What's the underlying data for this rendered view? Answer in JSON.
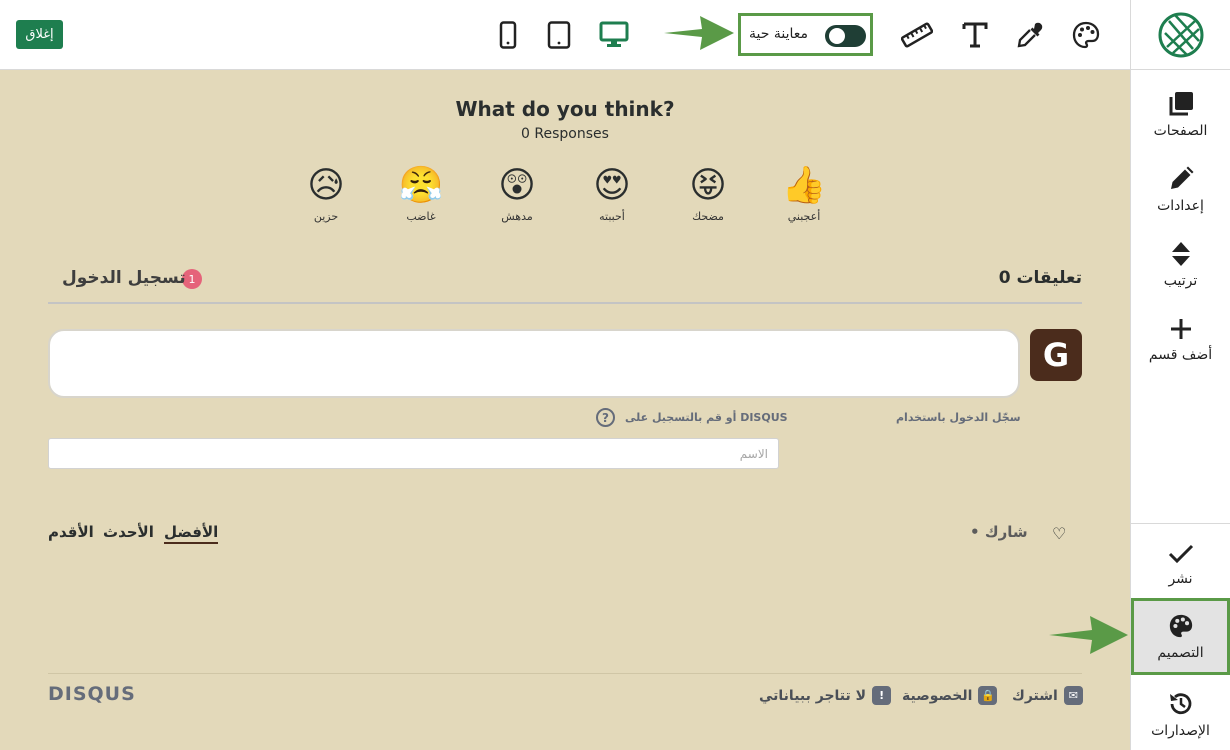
{
  "topbar": {
    "close_label": "إغلاق",
    "preview_label": "معاينة حية",
    "preview_on": true,
    "icons": [
      "mobile-icon",
      "tablet-icon",
      "desktop-icon",
      "ruler-icon",
      "text-icon",
      "eyedropper-icon",
      "palette-icon"
    ],
    "accent": "#1e7e4f"
  },
  "sidebar": {
    "items": [
      {
        "label": "الصفحات",
        "icon": "pages-icon"
      },
      {
        "label": "إعدادات",
        "icon": "pencil-icon"
      },
      {
        "label": "ترتيب",
        "icon": "sort-icon"
      },
      {
        "label": "أضف قسم",
        "icon": "plus-icon"
      }
    ],
    "bottom_items": [
      {
        "label": "نشر",
        "icon": "check-icon"
      },
      {
        "label": "التصميم",
        "icon": "palette-icon",
        "active": true
      },
      {
        "label": "الإصدارات",
        "icon": "history-icon"
      }
    ]
  },
  "widget": {
    "title": "What do you think?",
    "responses": "0 Responses",
    "reactions": [
      {
        "label": "أعجبني",
        "emoji": "👍"
      },
      {
        "label": "مضحك",
        "emoji": "😝"
      },
      {
        "label": "أحببته",
        "emoji": "😍"
      },
      {
        "label": "مدهش",
        "emoji": "😲"
      },
      {
        "label": "غاضب",
        "emoji": "😤"
      },
      {
        "label": "حزين",
        "emoji": "😥"
      }
    ],
    "comments_count": "0 تعليقات",
    "login_tab": "تسجيل الدخول",
    "login_badge": "1",
    "avatar_letter": "G",
    "login_with": "سجّل الدخول باستخدام",
    "or_signup": "أو قم بالتسجيل على DISQUS",
    "help": "?",
    "name_placeholder": "الاسم",
    "share": "شارك",
    "share_bullet": "•",
    "sort": {
      "best": "الأفضل",
      "newest": "الأحدث",
      "oldest": "الأقدم"
    },
    "footer": {
      "subscribe": "اشترك",
      "privacy": "الخصوصية",
      "no_sell": "لا تتاجر ببياناتي",
      "logo": "DISQUS"
    },
    "background": "#e3d9ba"
  }
}
